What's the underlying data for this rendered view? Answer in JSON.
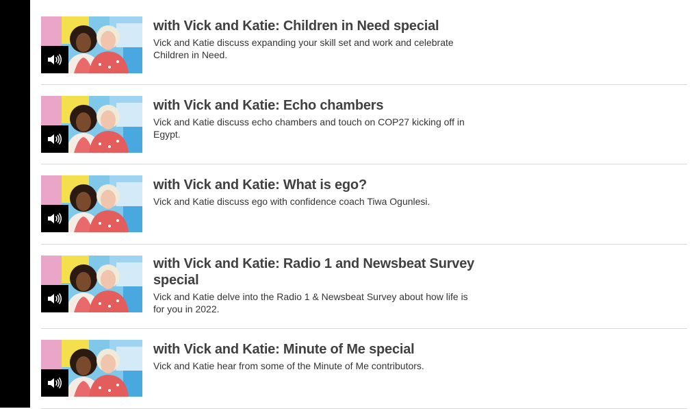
{
  "episodes": [
    {
      "title": "with Vick and Katie: Children in Need special",
      "description": "Vick and Katie discuss expanding your skill set and work and celebrate Children in Need.",
      "icon": "speaker-icon"
    },
    {
      "title": "with Vick and Katie: Echo chambers",
      "description": "Vick and Katie discuss echo chambers and touch on COP27 kicking off in Egypt.",
      "icon": "speaker-icon"
    },
    {
      "title": "with Vick and Katie: What is ego?",
      "description": "Vick and Katie discuss ego with confidence coach Tiwa Ogunlesi.",
      "icon": "speaker-icon"
    },
    {
      "title": "with Vick and Katie: Radio 1 and Newsbeat Survey special",
      "description": "Vick and Katie delve into the Radio 1 & Newsbeat Survey about how life is for you in 2022.",
      "icon": "speaker-icon"
    },
    {
      "title": "with Vick and Katie: Minute of Me special",
      "description": "Vick and Katie hear from some of the Minute of Me contributors.",
      "icon": "speaker-icon"
    }
  ],
  "colors": {
    "sidebar": "#000000",
    "title": "#404040",
    "text": "#333333",
    "divider": "#d6d6d6"
  }
}
